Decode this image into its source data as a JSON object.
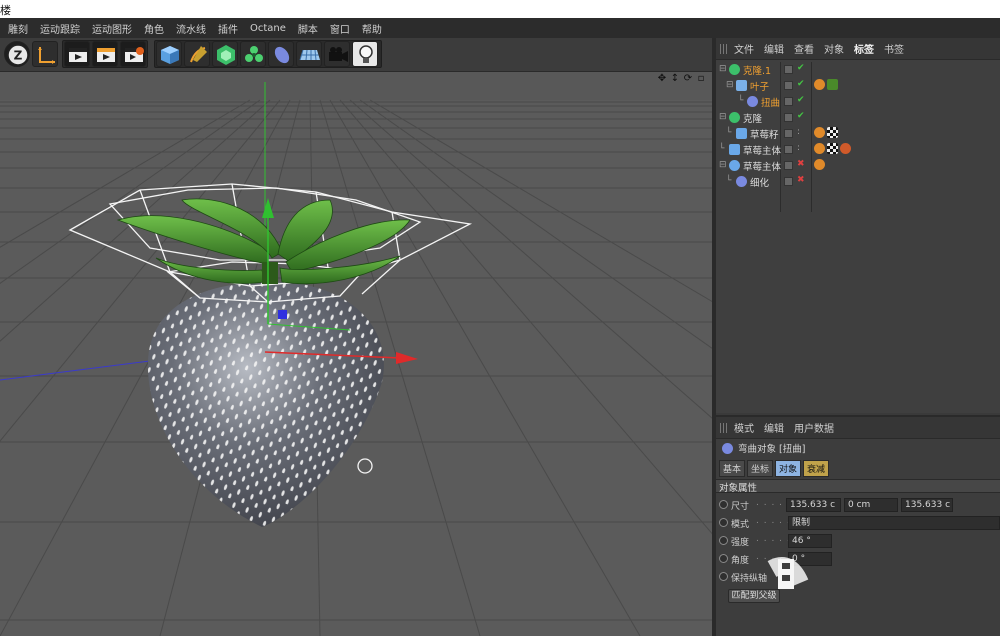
{
  "title_fragment": "楼",
  "menu": [
    "雕刻",
    "运动跟踪",
    "运动图形",
    "角色",
    "流水线",
    "插件",
    "Octane",
    "脚本",
    "窗口",
    "帮助"
  ],
  "object_manager": {
    "menu": [
      "文件",
      "编辑",
      "查看",
      "对象",
      "标签",
      "书签"
    ],
    "active_menu": "标签",
    "objects": [
      {
        "name": "克隆.1",
        "highlight": true,
        "indent": 0
      },
      {
        "name": "叶子",
        "highlight": true,
        "indent": 1
      },
      {
        "name": "扭曲",
        "highlight": true,
        "indent": 2
      },
      {
        "name": "克隆",
        "highlight": false,
        "indent": 0
      },
      {
        "name": "草莓籽",
        "highlight": false,
        "indent": 1
      },
      {
        "name": "草莓主体",
        "highlight": false,
        "indent": 1
      },
      {
        "name": "草莓主体",
        "highlight": false,
        "indent": 0
      },
      {
        "name": "细化",
        "highlight": false,
        "indent": 1
      }
    ]
  },
  "attribute_manager": {
    "menu": [
      "模式",
      "编辑",
      "用户数据"
    ],
    "object_title": "弯曲对象 [扭曲]",
    "tabs": [
      "基本",
      "坐标",
      "对象",
      "衰减"
    ],
    "active_tab": "对象",
    "section": "对象属性",
    "size_label": "尺寸",
    "size_values": [
      "135.633 c",
      "0 cm",
      "135.633 c"
    ],
    "mode_label": "模式",
    "mode_value": "限制",
    "strength_label": "强度",
    "strength_value": "46 °",
    "angle_label": "角度",
    "angle_value": "0 °",
    "keep_length_label": "保持纵轴",
    "match_button": "匹配到父级"
  },
  "colors": {
    "accent_orange": "#f0a030",
    "tab_active": "#8eb4e2",
    "check_green": "#44c444",
    "cross_red": "#e04040",
    "viewport_bg": "#585858"
  }
}
